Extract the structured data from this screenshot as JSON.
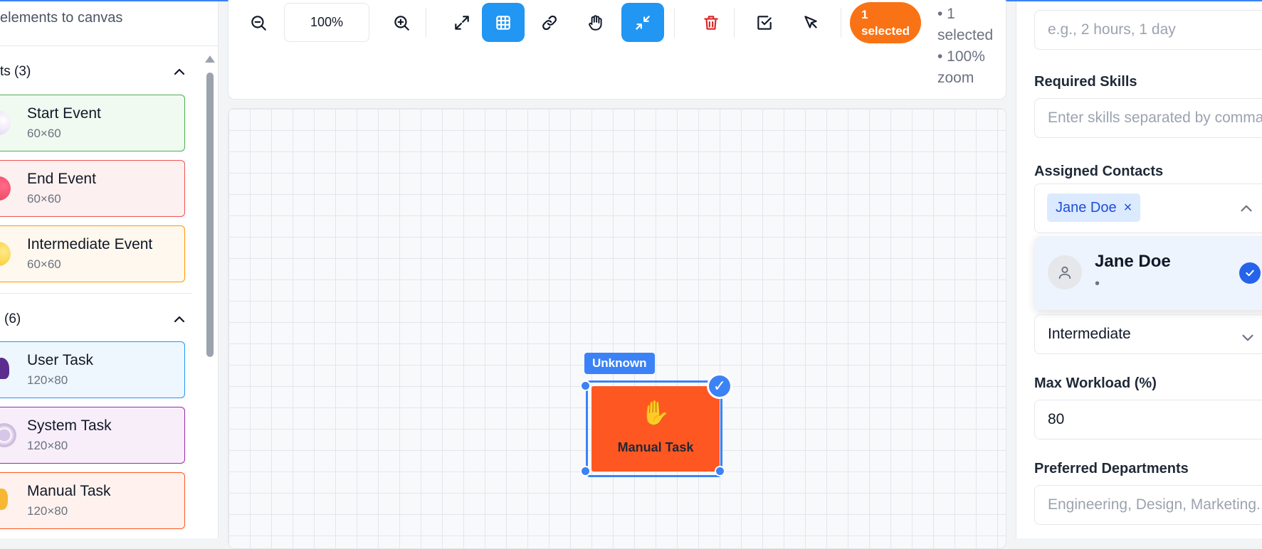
{
  "palette": {
    "hint": "elements to canvas",
    "events_header": "ts (3)",
    "tasks_header": "(6)",
    "items": [
      {
        "name": "Start Event",
        "size": "60×60"
      },
      {
        "name": "End Event",
        "size": "60×60"
      },
      {
        "name": "Intermediate Event",
        "size": "60×60"
      },
      {
        "name": "User Task",
        "size": "120×80"
      },
      {
        "name": "System Task",
        "size": "120×80"
      },
      {
        "name": "Manual Task",
        "size": "120×80"
      }
    ]
  },
  "toolbar": {
    "zoom_value": "100%",
    "selected_pill": [
      "1",
      "selected"
    ],
    "status_lines": [
      "• 1",
      "selected",
      "• 100%",
      "zoom"
    ]
  },
  "canvas": {
    "node_type_label": "Unknown",
    "node_icon": "✋",
    "node_text": "Manual Task",
    "node_color": "#ff5722"
  },
  "panel": {
    "duration_placeholder": "e.g., 2 hours, 1 day",
    "skills_label": "Required Skills",
    "skills_placeholder": "Enter skills separated by comma",
    "contacts_label": "Assigned Contacts",
    "chip_name": "Jane Doe",
    "chip_remove": "×",
    "dropdown_option_name": "Jane Doe",
    "dropdown_option_sub": "•",
    "level_value": "Intermediate",
    "workload_label": "Max Workload (%)",
    "workload_value": "80",
    "departments_label": "Preferred Departments",
    "departments_placeholder": "Engineering, Design, Marketing..."
  },
  "colors": {
    "accent": "#2196f3",
    "selection": "#3b82f6",
    "pill": "#f97316",
    "delete": "#dc2626"
  }
}
